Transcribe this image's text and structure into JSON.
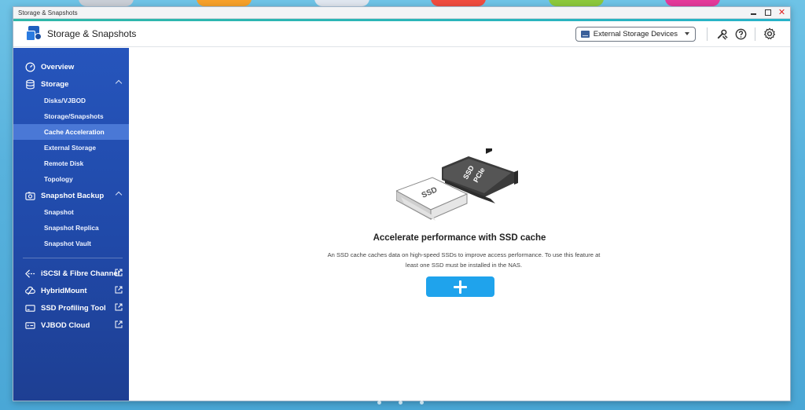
{
  "window": {
    "title": "Storage & Snapshots"
  },
  "header": {
    "app_title": "Storage & Snapshots",
    "external_select": "External Storage Devices",
    "icons": [
      "tools-icon",
      "help-icon",
      "settings-icon"
    ]
  },
  "sidebar": {
    "overview": "Overview",
    "storage": {
      "label": "Storage",
      "items": [
        "Disks/VJBOD",
        "Storage/Snapshots",
        "Cache Acceleration",
        "External Storage",
        "Remote Disk",
        "Topology"
      ]
    },
    "snapshot_backup": {
      "label": "Snapshot Backup",
      "items": [
        "Snapshot",
        "Snapshot Replica",
        "Snapshot Vault"
      ]
    },
    "external_links": [
      "iSCSI & Fibre Channel",
      "HybridMount",
      "SSD Profiling Tool",
      "VJBOD Cloud"
    ],
    "active_item": "Cache Acceleration"
  },
  "content": {
    "title": "Accelerate performance with SSD cache",
    "description": "An SSD cache caches data on high-speed SSDs to improve access performance. To use this feature at least one SSD must be installed in the NAS.",
    "illustration": {
      "ssd_label": "SSD",
      "pcie_label_1": "SSD",
      "pcie_label_2": "PCIe"
    }
  },
  "colors": {
    "sidebar": "#2049a8",
    "active": "#4a78d6",
    "button": "#1fa3ec",
    "accent": "#2fb8a8"
  }
}
